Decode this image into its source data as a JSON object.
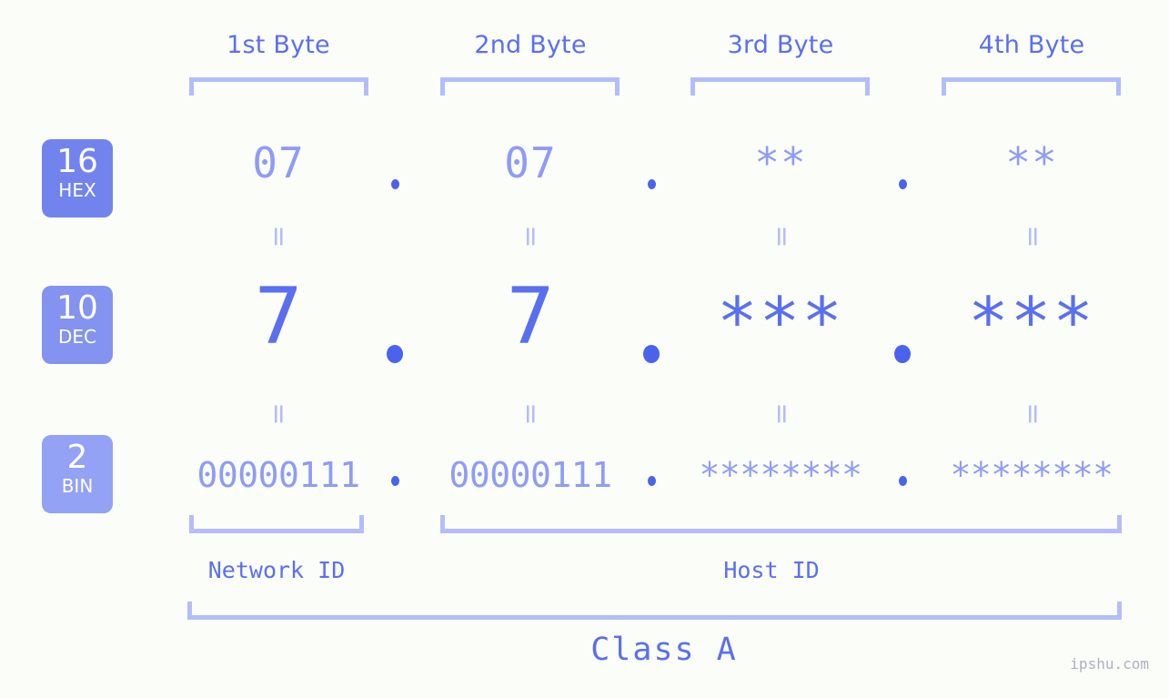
{
  "meta": {
    "background_color": "#fbfdf8",
    "accent_dark": "#5a6ff0",
    "accent_light": "#b3bdfa",
    "dot_color": "#4a62ee"
  },
  "byte_headers": [
    {
      "label": "1st Byte"
    },
    {
      "label": "2nd Byte"
    },
    {
      "label": "3rd Byte"
    },
    {
      "label": "4th Byte"
    }
  ],
  "bases": [
    {
      "number": "16",
      "unit": "HEX",
      "color": "#7383ee"
    },
    {
      "number": "10",
      "unit": "DEC",
      "color": "#8493f0"
    },
    {
      "number": "2",
      "unit": "BIN",
      "color": "#93a2f4"
    }
  ],
  "rows": {
    "hex": {
      "values": [
        "07",
        "07",
        "**",
        "**"
      ]
    },
    "dec": {
      "values": [
        "7",
        "7",
        "***",
        "***"
      ]
    },
    "bin": {
      "values": [
        "00000111",
        "00000111",
        "********",
        "********"
      ]
    }
  },
  "separators": {
    "glyph": ".",
    "equals_glyph": "="
  },
  "segments": [
    {
      "label": "Network ID"
    },
    {
      "label": "Host ID"
    }
  ],
  "class": {
    "label": "Class A"
  },
  "watermark": {
    "text": "ipshu.com"
  }
}
